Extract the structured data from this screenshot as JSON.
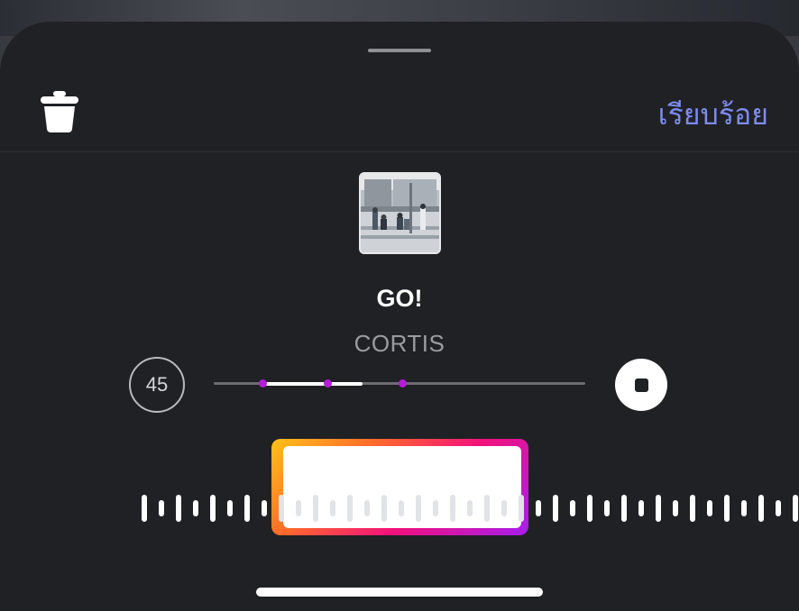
{
  "header": {
    "done_label": "เรียบร้อย",
    "delete_icon": "trash-icon"
  },
  "track": {
    "title": "GO!",
    "artist": "CORTIS",
    "artwork_icon": "album-artwork"
  },
  "player": {
    "clip_duration_label": "45",
    "progress_fraction": 0.4,
    "selection_start_fraction": 0.13,
    "stop_icon": "stop-icon"
  },
  "colors": {
    "accent": "#7d8cf0",
    "sheet_background": "#202125",
    "marker": "#b51ed6"
  }
}
